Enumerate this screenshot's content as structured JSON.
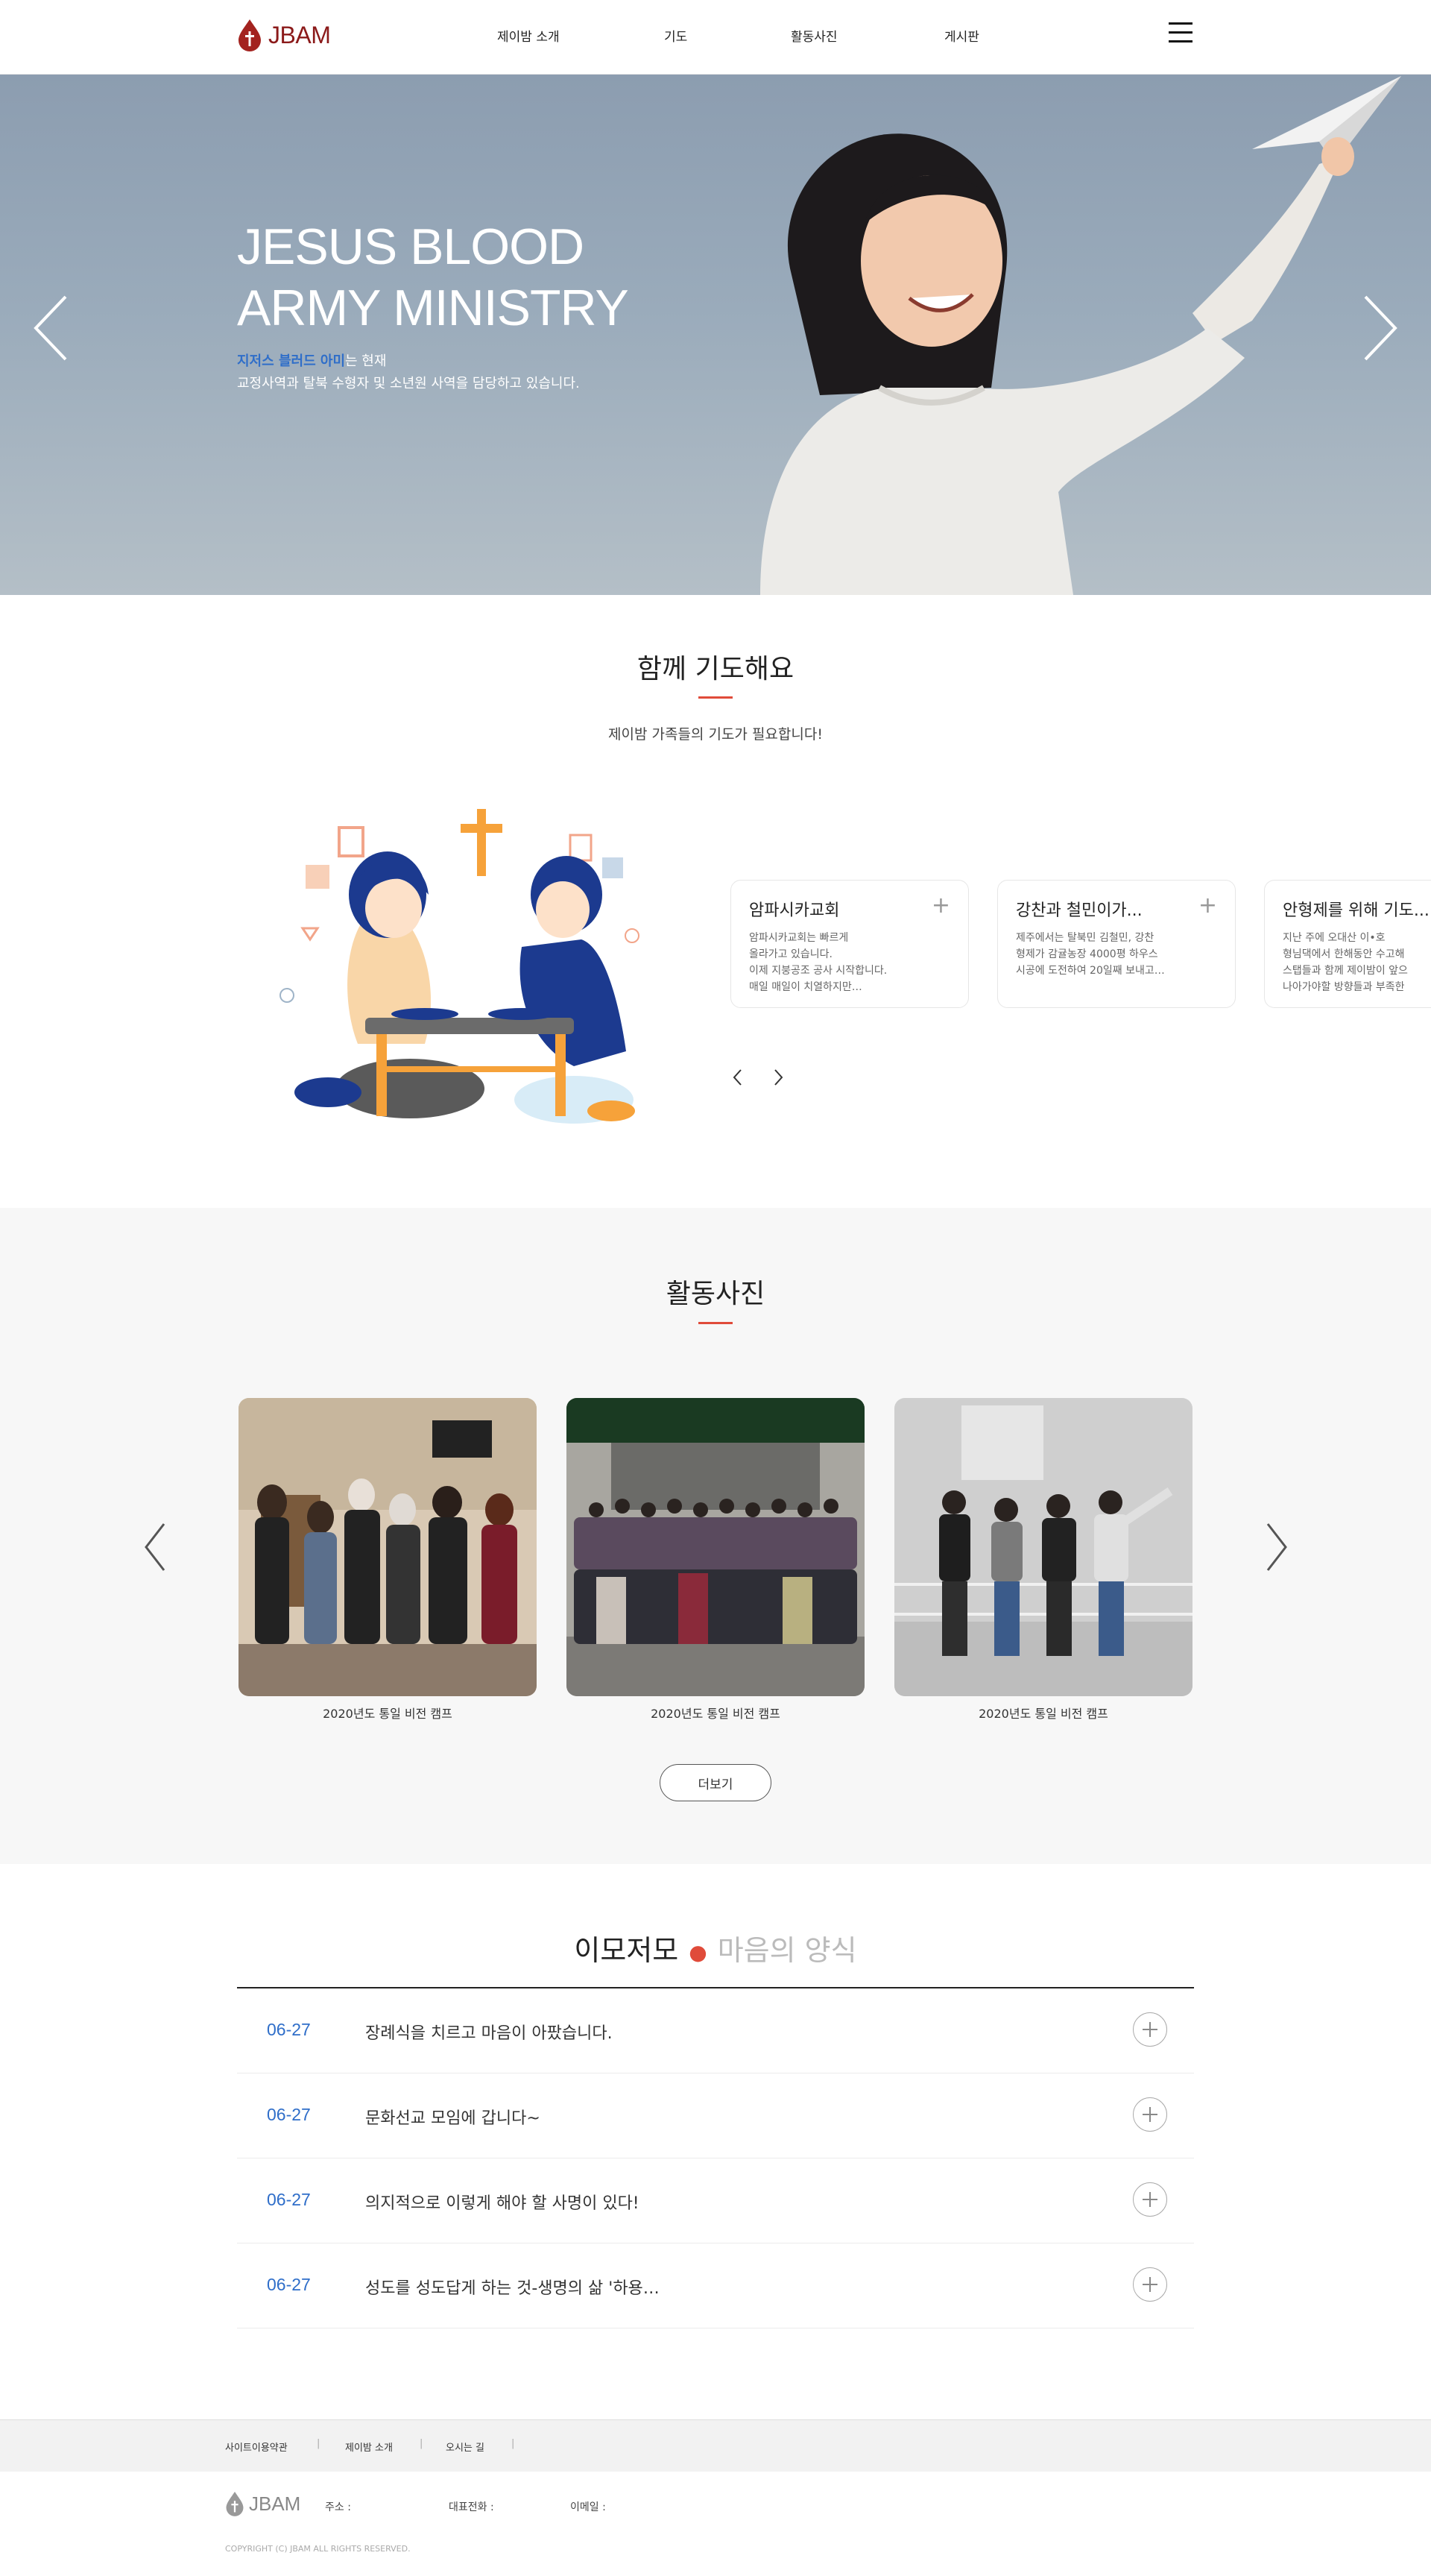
{
  "header": {
    "logo_text": "JBAM",
    "nav": [
      "제이밤 소개",
      "기도",
      "활동사진",
      "게시판"
    ]
  },
  "hero": {
    "title_line1": "JESUS BLOOD",
    "title_line2": "ARMY MINISTRY",
    "desc_highlight": "지저스 블러드 아미",
    "desc_rest": "는 현재",
    "desc_line2": "교정사역과 탈북 수형자 및 소년원 사역을 담당하고 있습니다."
  },
  "prayer": {
    "title": "함께 기도해요",
    "subtitle": "제이밤 가족들의 기도가 필요합니다!",
    "cards": [
      {
        "title": "암파시카교회",
        "body": [
          "암파시카교회는 빠르게",
          "올라가고 있습니다.",
          "이제 지붕공조 공사 시작합니다.",
          "매일 매일이 치열하지만…"
        ]
      },
      {
        "title": "강찬과 철민이가...",
        "body": [
          "제주에서는 탈북민 김철민, 강찬",
          "형제가 감귤농장 4000평 하우스",
          "시공에 도전하여 20일째 보내고…"
        ]
      },
      {
        "title": "안형제를 위해 기도...",
        "body": [
          "지난 주에 오대산 이•호",
          "형님댁에서 한해동안 수고해",
          "스탭들과 함께 제이밤이 앞으",
          "나아가야할 방향들과 부족한"
        ]
      }
    ]
  },
  "activity": {
    "title": "활동사진",
    "photos": [
      {
        "caption": "2020년도 통일 비전 캠프"
      },
      {
        "caption": "2020년도 통일 비전 캠프",
        "banner": "제화교회 기독교문화 선터예배 2017.12.21(목) 서울남부교도소"
      },
      {
        "caption": "2020년도 통일 비전 캠프"
      }
    ],
    "more_label": "더보기"
  },
  "notice": {
    "title_a": "이모저모",
    "title_dot": "●",
    "title_b": "마음의 양식",
    "items": [
      {
        "date": "06-27",
        "text": "장례식을 치르고 마음이 아팠습니다."
      },
      {
        "date": "06-27",
        "text": "문화선교 모임에 갑니다~"
      },
      {
        "date": "06-27",
        "text": "의지적으로 이렇게 해야 할 사명이 있다!"
      },
      {
        "date": "06-27",
        "text": "성도를 성도답게 하는 것-생명의 삶 '하용…"
      }
    ]
  },
  "footer": {
    "links": [
      "사이트이용약관",
      "제이밤 소개",
      "오시는 길"
    ],
    "sep": "|",
    "logo_text": "JBAM",
    "address_label": "주소 :",
    "phone_label": "대표전화 :",
    "email_label": "이메일 :",
    "copyright": "COPYRIGHT (C) JBAM ALL RIGHTS RESERVED."
  },
  "colors": {
    "brand": "#8b1a1a",
    "accent": "#e04b3a",
    "date_blue": "#2f6ec9",
    "activity_bg": "#f7f7f7"
  },
  "icons": [
    "logo-drop-icon",
    "hamburger-menu-icon",
    "chevron-left-icon",
    "chevron-right-icon",
    "plus-icon",
    "plus-circle-icon"
  ]
}
